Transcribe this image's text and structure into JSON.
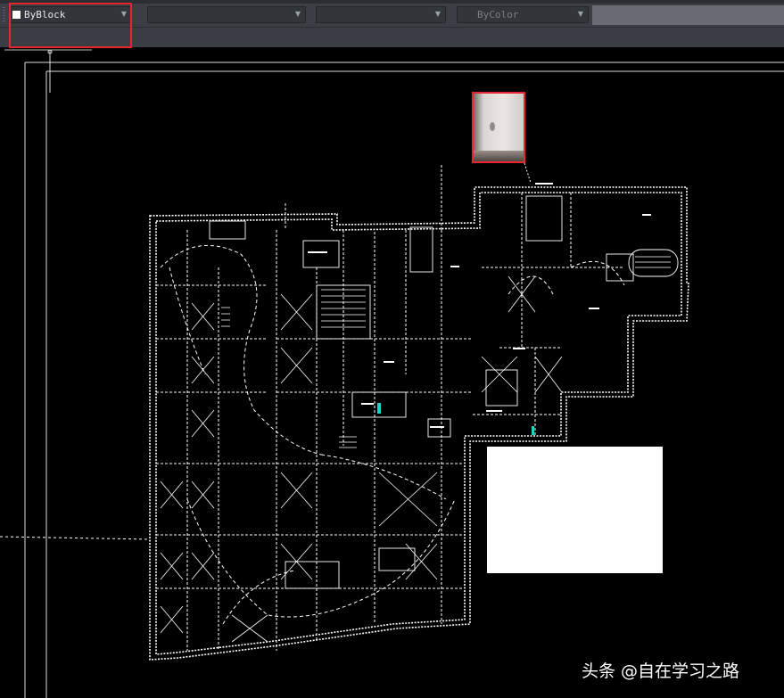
{
  "toolbar": {
    "linetype_combo": {
      "value": "ByBlock",
      "swatch_color": "#ffffff"
    },
    "layer_combo_2": {
      "value": ""
    },
    "layer_combo_3": {
      "value": ""
    },
    "color_combo": {
      "value": "ByColor"
    }
  },
  "colors": {
    "toolbar_bg": "#3b3f45",
    "highlight": "#e8242c",
    "drawing_bg": "#000000",
    "drawing_lines": "#ffffff"
  },
  "watermark": {
    "text": "头条 @自在学习之路"
  }
}
